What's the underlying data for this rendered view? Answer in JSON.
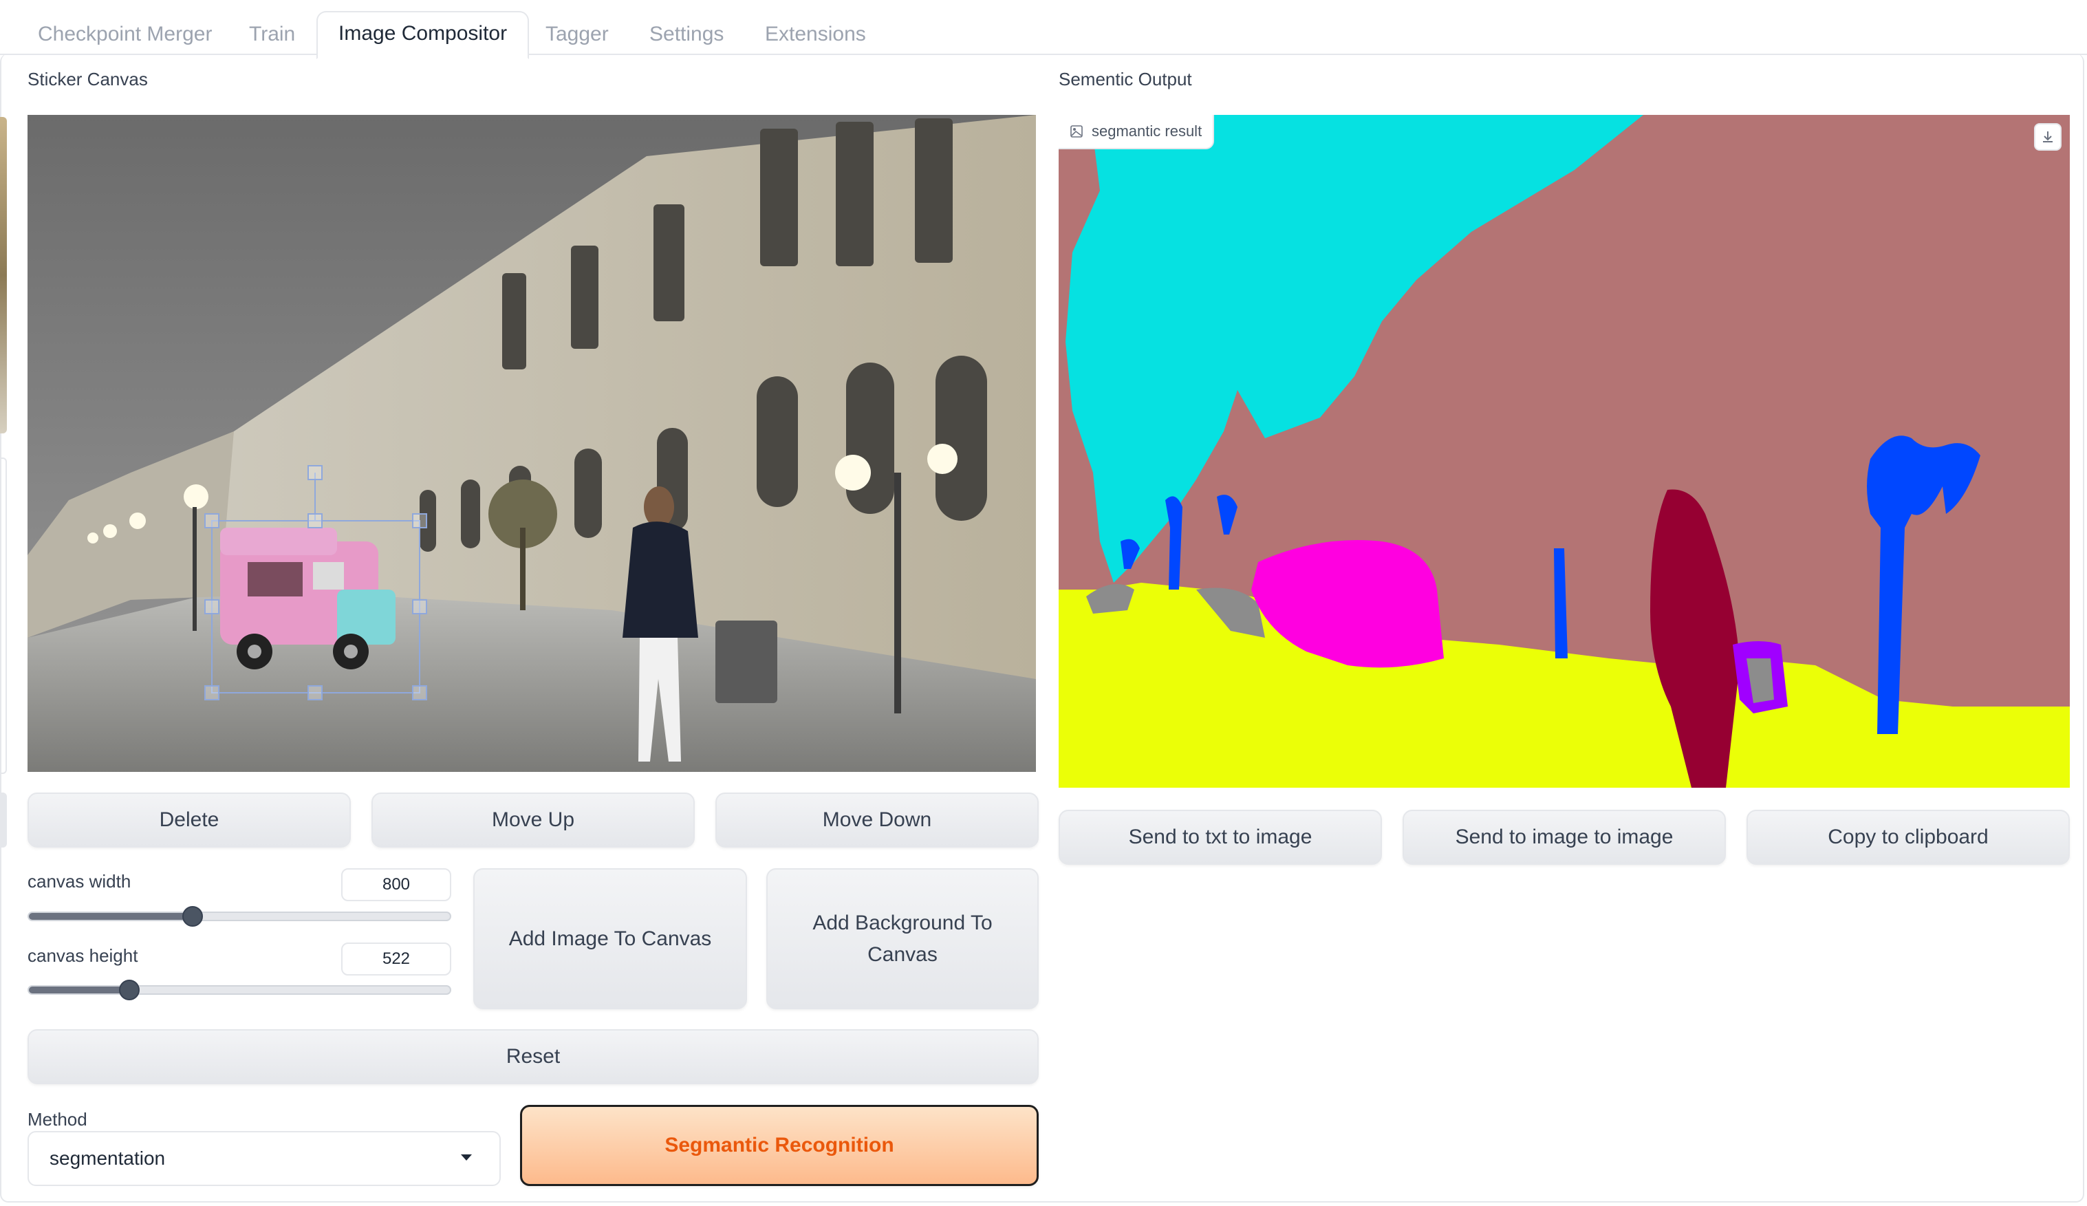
{
  "tabs": [
    {
      "label": "Checkpoint Merger",
      "active": false
    },
    {
      "label": "Train",
      "active": false
    },
    {
      "label": "Image Compositor",
      "active": true
    },
    {
      "label": "Tagger",
      "active": false
    },
    {
      "label": "Settings",
      "active": false
    },
    {
      "label": "Extensions",
      "active": false
    }
  ],
  "left": {
    "canvas_label": "Sticker Canvas",
    "delete_label": "Delete",
    "move_up_label": "Move Up",
    "move_down_label": "Move Down",
    "canvas_width_label": "canvas width",
    "canvas_width_value": "800",
    "canvas_width_slider_fraction": 0.39,
    "canvas_height_label": "canvas height",
    "canvas_height_value": "522",
    "canvas_height_slider_fraction": 0.24,
    "add_image_label": "Add Image To Canvas",
    "add_background_label": "Add Background To Canvas",
    "reset_label": "Reset",
    "method_label": "Method",
    "method_value": "segmentation",
    "segment_button_label": "Segmantic Recognition"
  },
  "right": {
    "output_label": "Sementic Output",
    "badge_label": "segmantic result",
    "send_txt_label": "Send to txt to image",
    "send_img_label": "Send to image to image",
    "copy_label": "Copy to clipboard"
  },
  "colors": {
    "accent": "#ea580c",
    "primary_bg": "#fdba8c",
    "seg_sky": "#06e1e1",
    "seg_building": "#b47474",
    "seg_ground": "#ebff07",
    "seg_vehicle": "#ff00e0",
    "seg_person": "#960032",
    "seg_tree": "#0047ff",
    "seg_misc": "#8c8c8c"
  }
}
